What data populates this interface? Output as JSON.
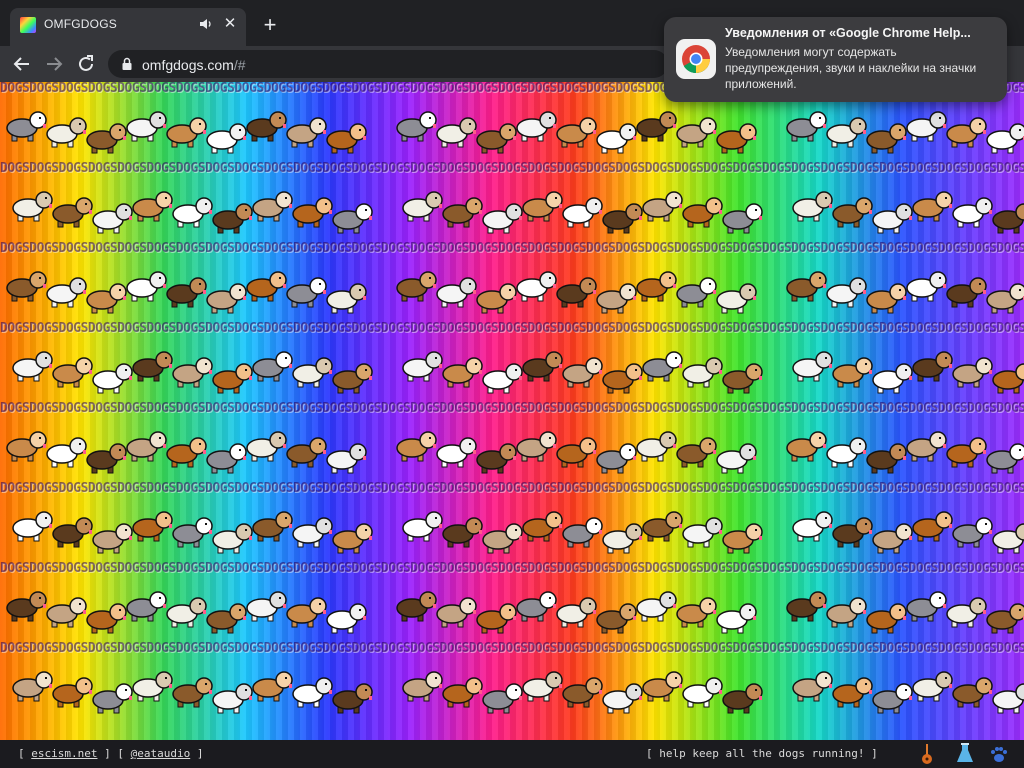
{
  "tab": {
    "title": "OMFGDOGS",
    "audio_icon": "speaker-icon",
    "close_label": "✕",
    "new_tab_label": "+"
  },
  "toolbar": {
    "back_icon": "back-arrow-icon",
    "forward_icon": "forward-arrow-icon",
    "reload_icon": "reload-icon",
    "url_host": "omfgdogs.com",
    "url_path": "/#"
  },
  "content": {
    "background_word": "DOGS",
    "rows": 8,
    "palette": [
      "#ff6a00",
      "#ffe600",
      "#35d85a",
      "#1ec8ff",
      "#2b39ff",
      "#9b22ff",
      "#ff1e8c",
      "#42e52b"
    ]
  },
  "footer": {
    "left_open": "[ ",
    "link1": "escism.net",
    "sep": " ] [ ",
    "link2": "@eataudio",
    "left_close": " ]",
    "right_text": "[ help keep all the dogs running! ]",
    "icons": [
      "guitar-icon",
      "flask-icon",
      "paw-icon"
    ]
  },
  "notification": {
    "title": "Уведомления от «Google Chrome Help...",
    "body": "Уведомления могут содержать предупреждения, звуки и наклейки на значки приложений.",
    "icon": "chrome-logo-icon"
  },
  "colors": {
    "chrome_dark": "#202124",
    "toolbar": "#35363a",
    "text_light": "#e8eaed"
  }
}
